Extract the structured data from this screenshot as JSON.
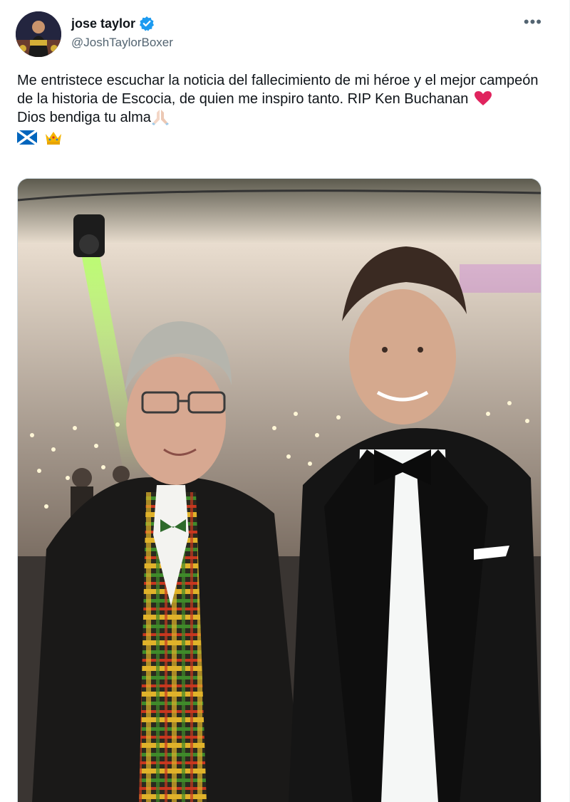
{
  "author": {
    "display_name": "jose taylor",
    "handle": "@JoshTaylorBoxer",
    "verified": true,
    "avatar_icon": "avatar-photo"
  },
  "menu": {
    "more_label": "•••"
  },
  "tweet": {
    "line1": "Me entristece escuchar la noticia del fallecimiento de mi héroe y el mejor campeón de la historia de Escocia, de quien me inspiro tanto. RIP Ken Buchanan",
    "line1_emoji": "red-heart-icon",
    "line2": "Dios bendiga tu alma",
    "line2_emoji": "folded-hands-icon",
    "line3_emojis": [
      "scotland-flag-icon",
      "crown-icon"
    ]
  },
  "media": {
    "type": "photo",
    "icon": "photo-two-men-formal-event"
  },
  "colors": {
    "verified_blue": "#1d9bf0",
    "text_primary": "#0f1419",
    "text_secondary": "#536471",
    "heart_red": "#e0245e"
  }
}
